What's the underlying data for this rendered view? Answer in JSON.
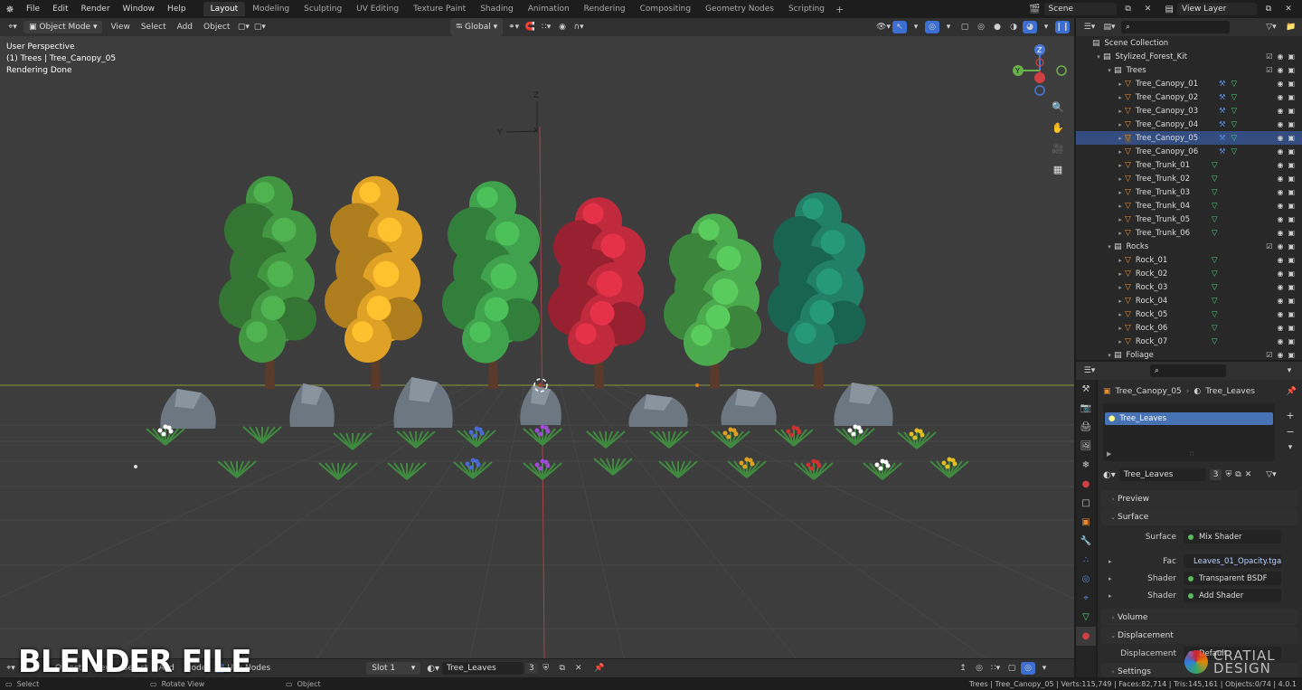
{
  "top_menu": {
    "items": [
      "File",
      "Edit",
      "Render",
      "Window",
      "Help"
    ],
    "workspaces": [
      "Layout",
      "Modeling",
      "Sculpting",
      "UV Editing",
      "Texture Paint",
      "Shading",
      "Animation",
      "Rendering",
      "Compositing",
      "Geometry Nodes",
      "Scripting"
    ],
    "active_workspace": "Layout",
    "add_workspace": "+",
    "scene": "Scene",
    "view_layer": "View Layer"
  },
  "viewport_header": {
    "mode": "Object Mode",
    "menus": [
      "View",
      "Select",
      "Add",
      "Object"
    ],
    "transform_orientation": "Global"
  },
  "viewport": {
    "overlay_lines": [
      "User Perspective",
      "(1) Trees | Tree_Canopy_05",
      "Rendering Done"
    ],
    "axis_labels": {
      "z": "Z",
      "y": "Y",
      "x": "X"
    },
    "gizmo": {
      "z": "Z",
      "y": "Y"
    },
    "tree_colors": [
      "#3f8f3f",
      "#d49a24",
      "#3d9a48",
      "#b8283a",
      "#48a24a",
      "#1f7a62"
    ],
    "watermark": "BLENDER FILE",
    "brand": [
      "CRATIAL",
      "DESIGN"
    ]
  },
  "outliner": {
    "search_placeholder": "",
    "rows": [
      {
        "label": "Scene Collection",
        "indent": 0,
        "type": "scene"
      },
      {
        "label": "Stylized_Forest_Kit",
        "indent": 1,
        "type": "collection"
      },
      {
        "label": "Trees",
        "indent": 2,
        "type": "collection"
      },
      {
        "label": "Tree_Canopy_01",
        "indent": 3,
        "type": "mesh",
        "mods": true
      },
      {
        "label": "Tree_Canopy_02",
        "indent": 3,
        "type": "mesh",
        "mods": true
      },
      {
        "label": "Tree_Canopy_03",
        "indent": 3,
        "type": "mesh",
        "mods": true
      },
      {
        "label": "Tree_Canopy_04",
        "indent": 3,
        "type": "mesh",
        "mods": true
      },
      {
        "label": "Tree_Canopy_05",
        "indent": 3,
        "type": "mesh",
        "mods": true,
        "active": true
      },
      {
        "label": "Tree_Canopy_06",
        "indent": 3,
        "type": "mesh",
        "mods": true
      },
      {
        "label": "Tree_Trunk_01",
        "indent": 3,
        "type": "mesh"
      },
      {
        "label": "Tree_Trunk_02",
        "indent": 3,
        "type": "mesh"
      },
      {
        "label": "Tree_Trunk_03",
        "indent": 3,
        "type": "mesh"
      },
      {
        "label": "Tree_Trunk_04",
        "indent": 3,
        "type": "mesh"
      },
      {
        "label": "Tree_Trunk_05",
        "indent": 3,
        "type": "mesh"
      },
      {
        "label": "Tree_Trunk_06",
        "indent": 3,
        "type": "mesh"
      },
      {
        "label": "Rocks",
        "indent": 2,
        "type": "collection"
      },
      {
        "label": "Rock_01",
        "indent": 3,
        "type": "mesh"
      },
      {
        "label": "Rock_02",
        "indent": 3,
        "type": "mesh"
      },
      {
        "label": "Rock_03",
        "indent": 3,
        "type": "mesh"
      },
      {
        "label": "Rock_04",
        "indent": 3,
        "type": "mesh"
      },
      {
        "label": "Rock_05",
        "indent": 3,
        "type": "mesh"
      },
      {
        "label": "Rock_06",
        "indent": 3,
        "type": "mesh"
      },
      {
        "label": "Rock_07",
        "indent": 3,
        "type": "mesh"
      },
      {
        "label": "Foliage",
        "indent": 2,
        "type": "collection"
      }
    ]
  },
  "properties": {
    "breadcrumb_object": "Tree_Canopy_05",
    "breadcrumb_material": "Tree_Leaves",
    "slot_list_item": "Tree_Leaves",
    "material_name": "Tree_Leaves",
    "user_count": "3",
    "panels": {
      "preview": "Preview",
      "surface": "Surface",
      "volume": "Volume",
      "displacement": "Displacement",
      "settings": "Settings"
    },
    "surface_rows": [
      {
        "label": "Surface",
        "value": "Mix Shader",
        "dot": "#5cb85c",
        "expand": false,
        "highlight": false
      },
      {
        "label": "Fac",
        "value": "Leaves_01_Opacity.tga",
        "dot": "#7a7ad6",
        "expand": true,
        "highlight": true
      },
      {
        "label": "Shader",
        "value": "Transparent BSDF",
        "dot": "#5cb85c",
        "expand": true,
        "highlight": false
      },
      {
        "label": "Shader",
        "value": "Add Shader",
        "dot": "#5cb85c",
        "expand": true,
        "highlight": false
      }
    ],
    "displacement_label": "Displacement",
    "displacement_value": "Default"
  },
  "shader_header": {
    "menus": [
      "Object",
      "View",
      "Select",
      "Add",
      "Node"
    ],
    "use_nodes_label": "Use Nodes",
    "slot": "Slot 1",
    "material": "Tree_Leaves",
    "users": "3"
  },
  "statusbar": {
    "left": [
      {
        "icon": "mouse-left-icon",
        "label": "Select"
      },
      {
        "icon": "mouse-middle-icon",
        "label": "Rotate View"
      },
      {
        "icon": "mouse-right-icon",
        "label": "Object"
      }
    ],
    "stats": "Trees | Tree_Canopy_05 | Verts:115,749 | Faces:82,714 | Tris:145,161 | Objects:0/74 | 4.0.1"
  }
}
